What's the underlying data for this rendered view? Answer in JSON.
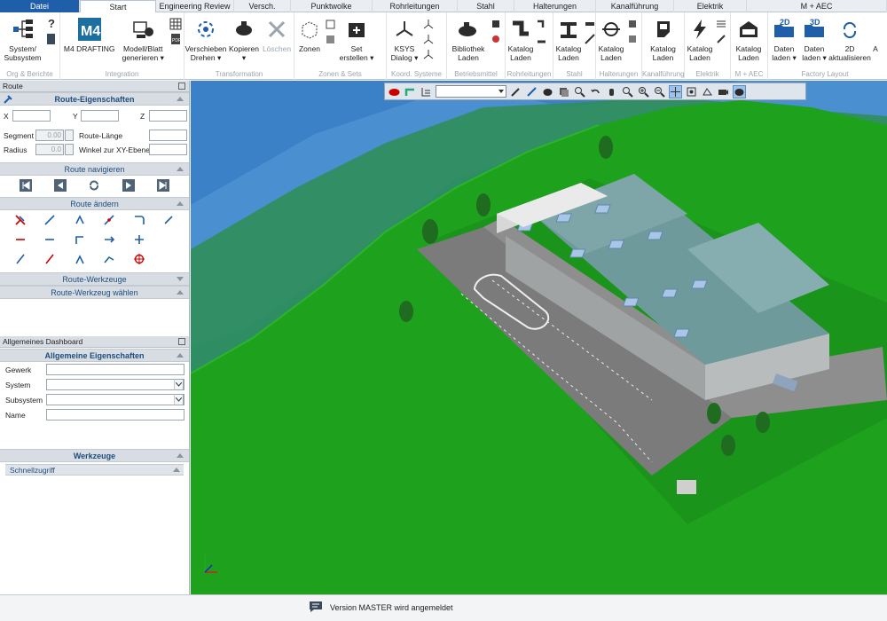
{
  "tabs": [
    "Datei",
    "Start",
    "Engineering Review",
    "Versch.",
    "Punktwolke",
    "Rohrleitungen",
    "Stahl",
    "Halterungen",
    "Kanalführung",
    "Elektrik",
    "M + AEC"
  ],
  "active_tab": "Start",
  "ribbon": {
    "org": {
      "label": "Org & Berichte",
      "btn1": "System/\nSubsystem"
    },
    "integration": {
      "label": "Integration",
      "btn1": "M4 DRAFTING",
      "btn2": "Modell/Blatt\ngenerieren ▾"
    },
    "transformation": {
      "label": "Transformation",
      "btn1": "Verschieben\nDrehen ▾",
      "btn2": "Kopieren\n▾",
      "btn3": "Löschen"
    },
    "zonen": {
      "label": "Zonen & Sets",
      "btn1": "Zonen",
      "btn2": "Set\nerstellen ▾"
    },
    "koord": {
      "label": "Koord. Systeme",
      "btn1": "KSYS\nDialog ▾"
    },
    "betrieb": {
      "label": "Betriebsmittel",
      "btn1": "Bibliothek\nLaden"
    },
    "rohr": {
      "label": "Rohrleitungen",
      "btn1": "Katalog\nLaden"
    },
    "stahl": {
      "label": "Stahl",
      "btn1": "Katalog\nLaden"
    },
    "halter": {
      "label": "Halterungen",
      "btn1": "Katalog\nLaden"
    },
    "kanal": {
      "label": "Kanalführung",
      "btn1": "Katalog\nLaden"
    },
    "elektrik": {
      "label": "Elektrik",
      "btn1": "Katalog\nLaden"
    },
    "maec": {
      "label": "M + AEC",
      "btn1": "Katalog\nLaden"
    },
    "factory": {
      "label": "Factory Layout",
      "btn1": "Daten\nladen ▾",
      "btn2": "Daten\nladen ▾",
      "btn3": "2D\naktualisieren",
      "btn4": "A"
    }
  },
  "route_panel": {
    "title": "Route",
    "section_props": "Route-Eigenschaften",
    "x_label": "X",
    "y_label": "Y",
    "z_label": "Z",
    "segment_label": "Segment",
    "segment_value": "0.00",
    "length_label": "Route-Länge",
    "radius_label": "Radius",
    "radius_value": "0.0",
    "angle_label": "Winkel zur XY-Ebene",
    "section_nav": "Route navigieren",
    "section_change": "Route ändern",
    "section_tools": "Route-Werkzeuge",
    "section_choose": "Route-Werkzeug wählen"
  },
  "dashboard": {
    "title": "Allgemeines Dashboard",
    "section_props": "Allgemeine Eigenschaften",
    "gewerk": "Gewerk",
    "system": "System",
    "subsystem": "Subsystem",
    "name": "Name",
    "section_tools": "Werkzeuge",
    "quick": "Schnellzugriff"
  },
  "status": {
    "message": "Version MASTER wird angemeldet"
  },
  "colors": {
    "file_tab": "#1f5ea8",
    "grass": "#1ea21e",
    "sky": "#3a7fc4",
    "roof": "#6f9a9c"
  }
}
